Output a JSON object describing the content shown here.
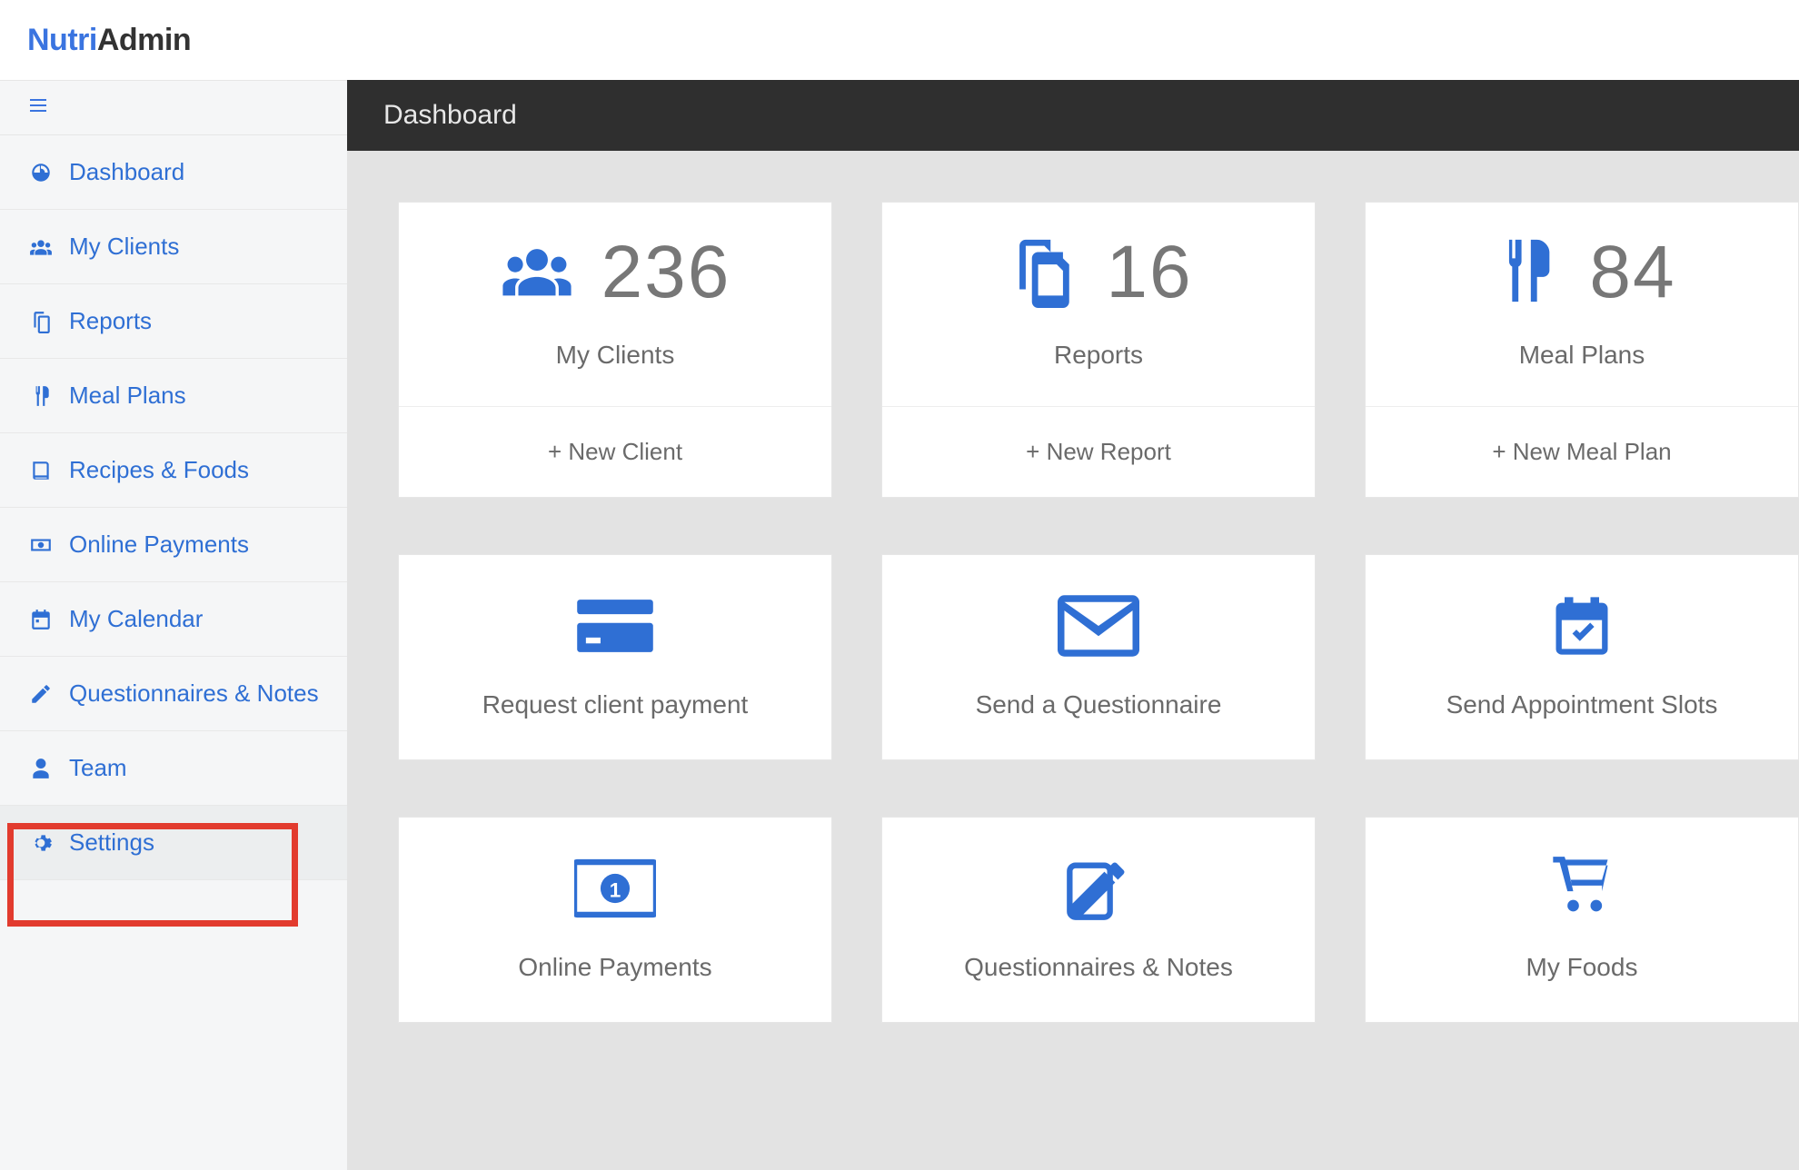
{
  "brand": {
    "part1": "Nutri",
    "part2": "Admin"
  },
  "page_title": "Dashboard",
  "sidebar": {
    "items": [
      {
        "label": "Dashboard",
        "icon": "dashboard-icon"
      },
      {
        "label": "My Clients",
        "icon": "clients-icon"
      },
      {
        "label": "Reports",
        "icon": "reports-icon"
      },
      {
        "label": "Meal Plans",
        "icon": "mealplans-icon"
      },
      {
        "label": "Recipes & Foods",
        "icon": "recipes-icon"
      },
      {
        "label": "Online Payments",
        "icon": "payments-icon"
      },
      {
        "label": "My Calendar",
        "icon": "calendar-icon"
      },
      {
        "label": "Questionnaires & Notes",
        "icon": "questionnaires-icon"
      },
      {
        "label": "Team",
        "icon": "team-icon"
      },
      {
        "label": "Settings",
        "icon": "settings-icon"
      }
    ]
  },
  "stats": [
    {
      "count": "236",
      "label": "My Clients",
      "action": "+ New Client",
      "icon": "clients-icon"
    },
    {
      "count": "16",
      "label": "Reports",
      "action": "+ New Report",
      "icon": "reports-icon"
    },
    {
      "count": "84",
      "label": "Meal Plans",
      "action": "+ New Meal Plan",
      "icon": "mealplans-icon"
    }
  ],
  "actions_row1": [
    {
      "label": "Request client payment",
      "icon": "creditcard-icon"
    },
    {
      "label": "Send a Questionnaire",
      "icon": "envelope-icon"
    },
    {
      "label": "Send Appointment Slots",
      "icon": "calendarcheck-icon"
    }
  ],
  "actions_row2": [
    {
      "label": "Online Payments",
      "icon": "money-icon"
    },
    {
      "label": "Questionnaires & Notes",
      "icon": "edit-icon"
    },
    {
      "label": "My Foods",
      "icon": "cart-icon"
    }
  ],
  "highlighted_item": "Settings"
}
